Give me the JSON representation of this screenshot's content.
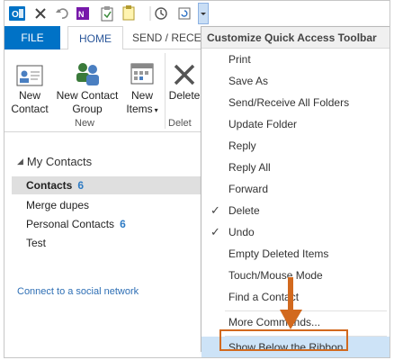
{
  "tabs": {
    "file": "FILE",
    "home": "HOME",
    "send": "SEND / RECEI"
  },
  "ribbon": {
    "new_contact": [
      "New",
      "Contact"
    ],
    "new_contact_group": [
      "New Contact",
      "Group"
    ],
    "new_items": [
      "New",
      "Items"
    ],
    "delete": "Delete",
    "group_new_label": "New",
    "group_delete_label": "Delet"
  },
  "pane": {
    "header": "My Contacts",
    "folders": [
      {
        "name": "Contacts",
        "count": "6",
        "selected": true
      },
      {
        "name": "Merge dupes",
        "count": ""
      },
      {
        "name": "Personal Contacts",
        "count": "6"
      },
      {
        "name": "Test",
        "count": ""
      }
    ],
    "social_link": "Connect to a social network"
  },
  "menu": {
    "title": "Customize Quick Access Toolbar",
    "items": [
      {
        "label": "Print",
        "checked": false
      },
      {
        "label": "Save As",
        "checked": false
      },
      {
        "label": "Send/Receive All Folders",
        "checked": false
      },
      {
        "label": "Update Folder",
        "checked": false
      },
      {
        "label": "Reply",
        "checked": false
      },
      {
        "label": "Reply All",
        "checked": false
      },
      {
        "label": "Forward",
        "checked": false
      },
      {
        "label": "Delete",
        "checked": true
      },
      {
        "label": "Undo",
        "checked": true
      },
      {
        "label": "Empty Deleted Items",
        "checked": false
      },
      {
        "label": "Touch/Mouse Mode",
        "checked": false
      },
      {
        "label": "Find a Contact",
        "checked": false
      }
    ],
    "more_commands": "More Commands...",
    "show_below": "Show Below the Ribbon"
  },
  "colors": {
    "accent": "#0072c6",
    "highlight": "#cde3f7",
    "annotation": "#d2691e"
  }
}
